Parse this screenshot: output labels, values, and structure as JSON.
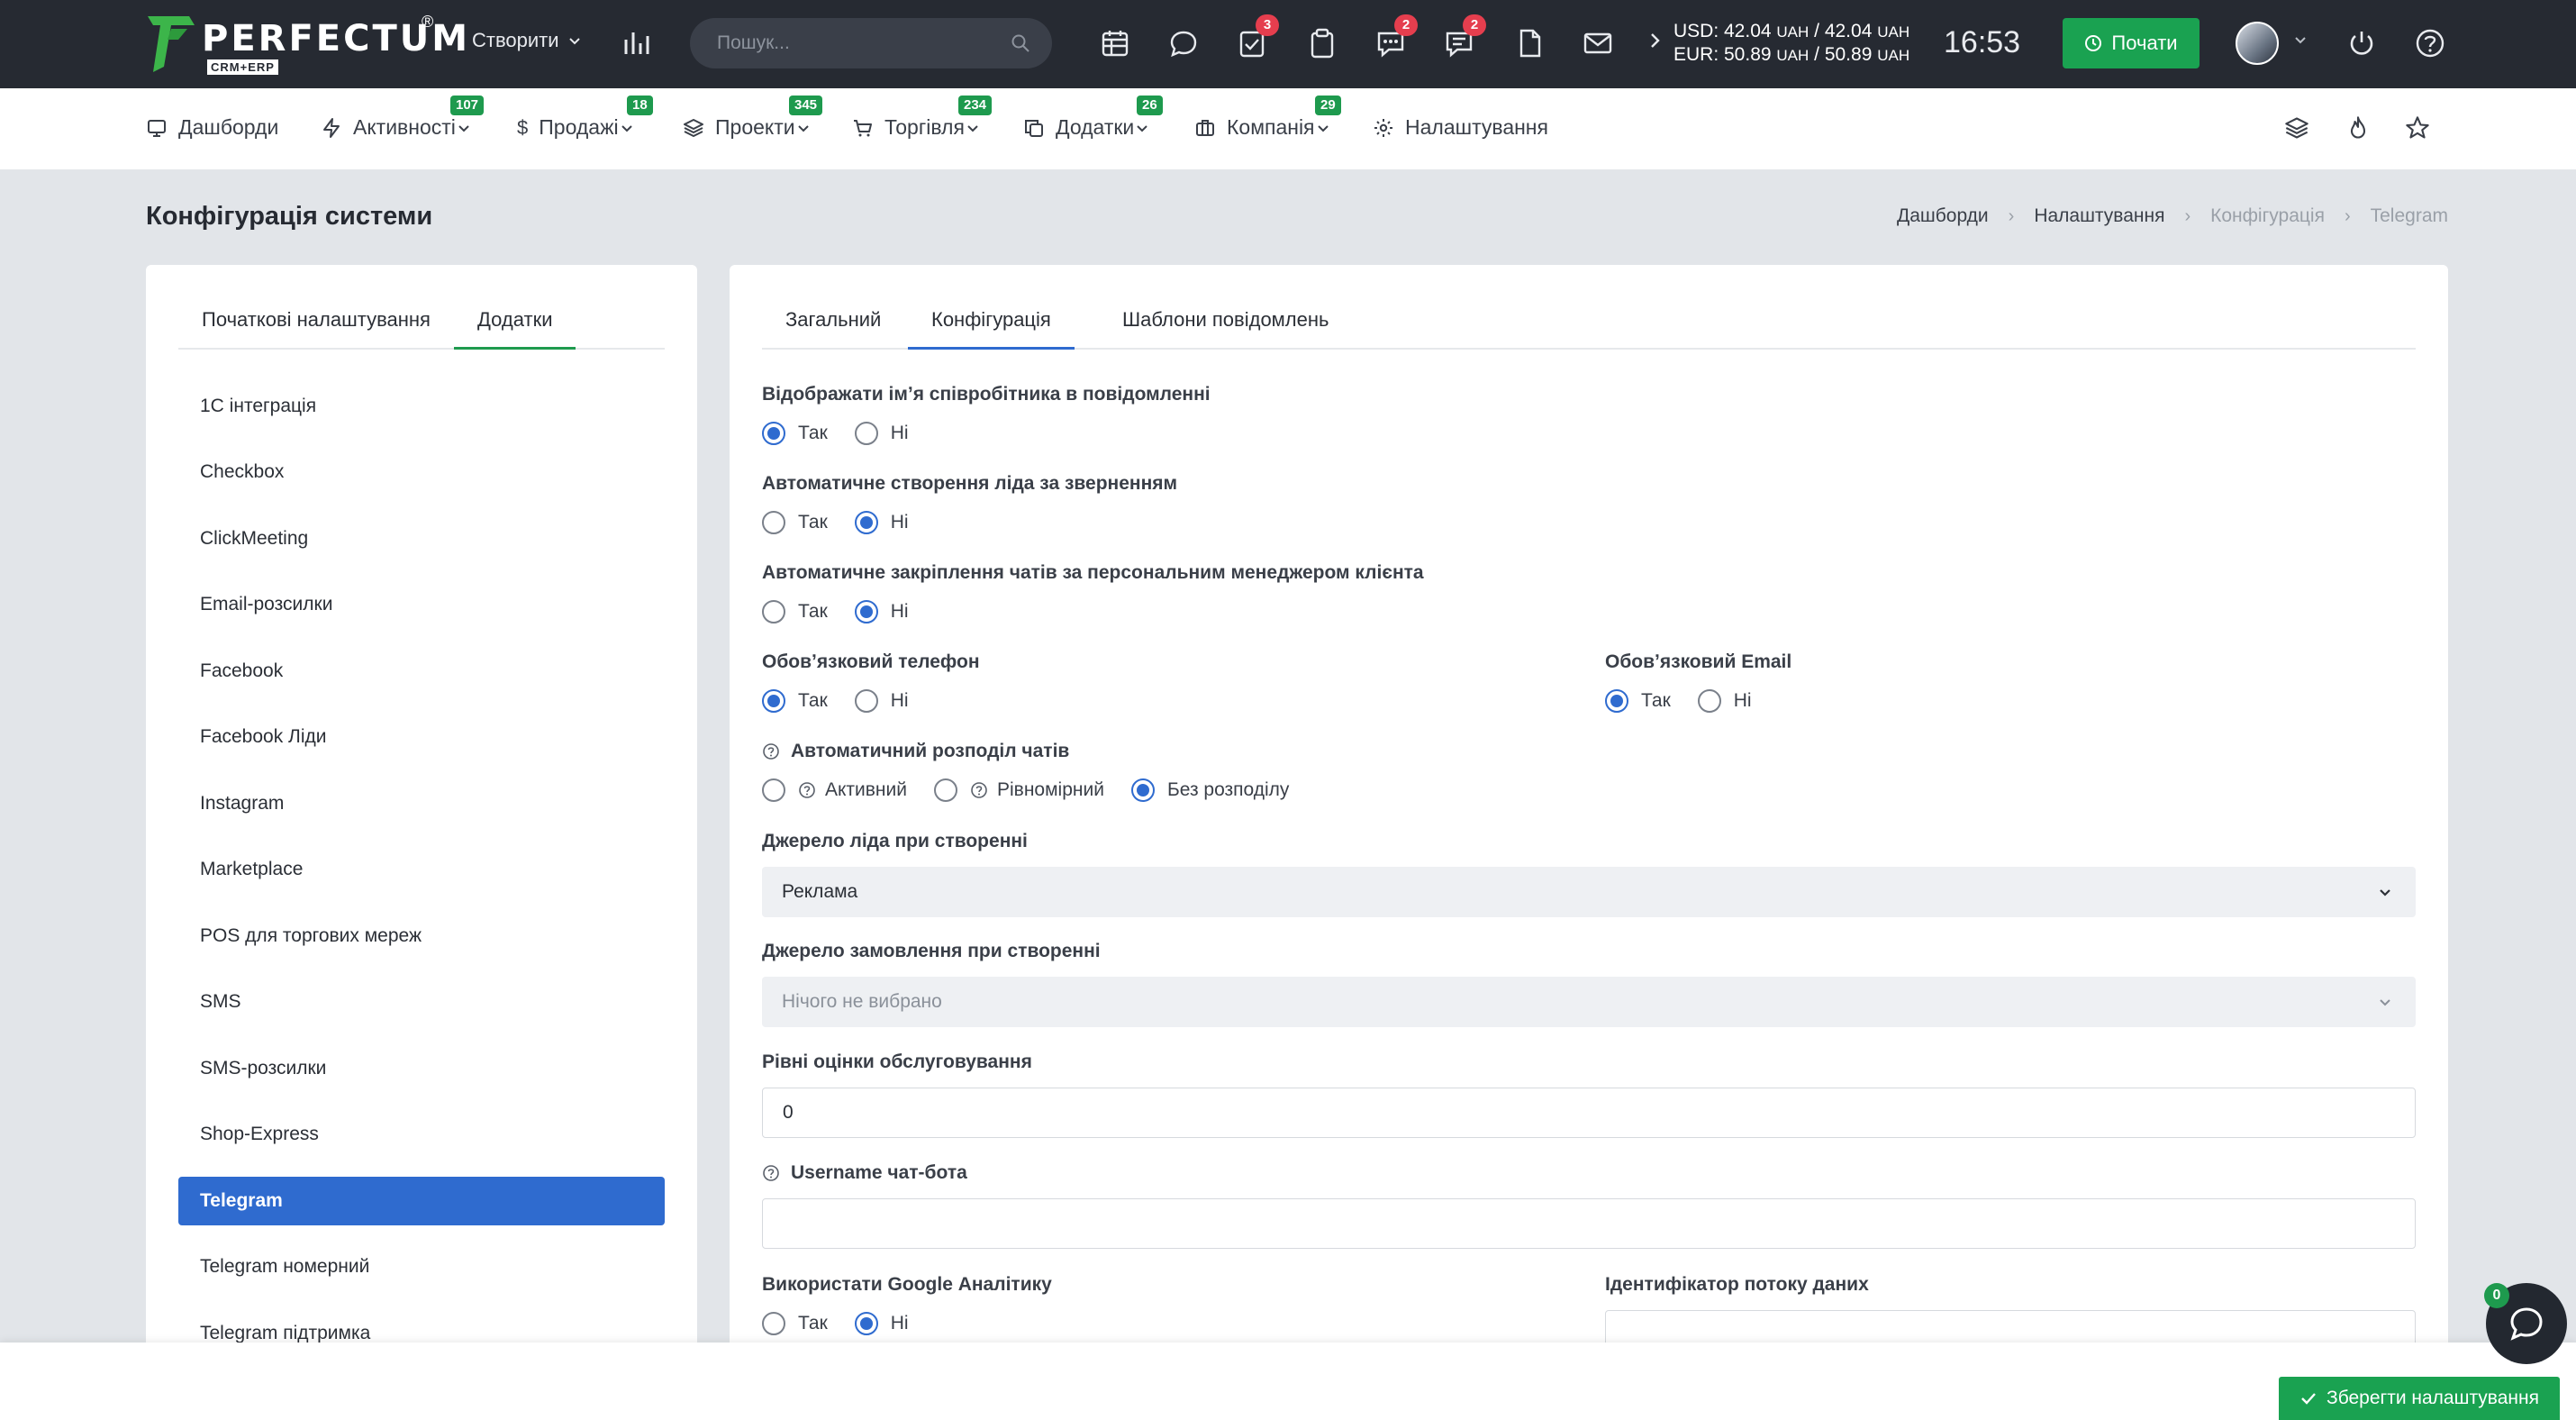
{
  "topbar": {
    "logo_word": "PERFECTUM",
    "logo_sub": "CRM+ERP",
    "logo_reg": "®",
    "create_label": "Створити",
    "search_placeholder": "Пошук...",
    "badges": {
      "tasks": "3",
      "chat": "2",
      "messages": "2"
    },
    "rates": {
      "usd": "USD: 42.04",
      "usd_unit1": "UAH",
      "usd_sep": "/ 42.04",
      "usd_unit2": "UAH",
      "eur": "EUR: 50.89",
      "eur_unit1": "UAH",
      "eur_sep": "/ 50.89",
      "eur_unit2": "UAH"
    },
    "clock": "16:53",
    "start_label": "Почати"
  },
  "nav": {
    "items": [
      {
        "label": "Дашборди",
        "badge": ""
      },
      {
        "label": "Активності",
        "badge": "107"
      },
      {
        "label": "Продажі",
        "badge": "18"
      },
      {
        "label": "Проекти",
        "badge": "345"
      },
      {
        "label": "Торгівля",
        "badge": "234"
      },
      {
        "label": "Додатки",
        "badge": "26"
      },
      {
        "label": "Компанія",
        "badge": "29"
      },
      {
        "label": "Налаштування",
        "badge": ""
      }
    ]
  },
  "page": {
    "title": "Конфігурація системи",
    "breadcrumb": [
      "Дашборди",
      "Налаштування",
      "Конфігурація",
      "Telegram"
    ]
  },
  "left": {
    "tabs": [
      "Початкові налаштування",
      "Додатки"
    ],
    "items": [
      "1С інтеграція",
      "Checkbox",
      "ClickMeeting",
      "Email-розсилки",
      "Facebook",
      "Facebook Ліди",
      "Instagram",
      "Marketplace",
      "POS для торгових мереж",
      "SMS",
      "SMS-розсилки",
      "Shop-Express",
      "Telegram",
      "Telegram номерний",
      "Telegram підтримка"
    ]
  },
  "right": {
    "tabs": [
      "Загальний",
      "Конфігурація",
      "Шаблони повідомлень"
    ],
    "yes": "Так",
    "no": "Ні",
    "fields": {
      "show_name": "Відображати імʼя співробітника в повідомленні",
      "auto_lead": "Автоматичне створення ліда за зверненням",
      "auto_pin": "Автоматичне закріплення чатів за персональним менеджером клієнта",
      "req_phone": "Обовʼязковий телефон",
      "req_email": "Обовʼязковий Email",
      "auto_dist": "Автоматичний розподіл чатів",
      "dist_active": "Активний",
      "dist_even": "Рівномірний",
      "dist_none": "Без розподілу",
      "lead_source": "Джерело ліда при створенні",
      "lead_source_value": "Реклама",
      "order_source": "Джерело замовлення при створенні",
      "order_source_value": "Нічого не вибрано",
      "rating_levels": "Рівні оцінки обслуговування",
      "rating_levels_value": "0",
      "bot_username": "Username чат-бота",
      "bot_username_value": "",
      "use_ga": "Використати Google Аналітику",
      "stream_id": "Ідентифікатор потоку даних"
    }
  },
  "bottom": {
    "save_label": "Зберегти налаштування",
    "chat_badge": "0"
  }
}
